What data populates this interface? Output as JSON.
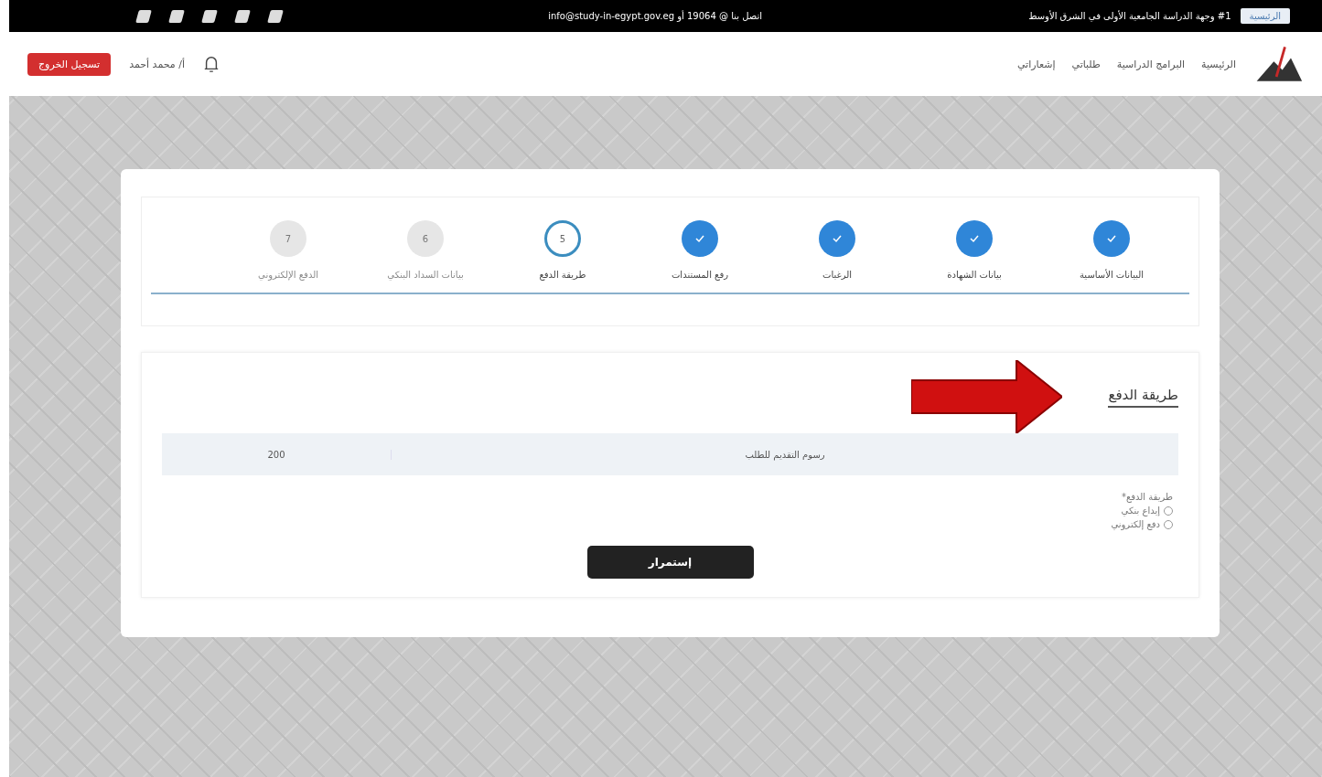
{
  "top_bar": {
    "badge": "الرئيسية",
    "tagline": "#1 وجهة الدراسة الجامعية الأولى في الشرق الأوسط",
    "contact": "اتصل بنا @ 19064 أو info@study-in-egypt.gov.eg"
  },
  "nav": {
    "items": [
      {
        "label": "الرئيسية"
      },
      {
        "label": "البرامج الدراسية"
      },
      {
        "label": "طلباتي"
      },
      {
        "label": "إشعاراتي"
      }
    ],
    "user": "أ/ محمد أحمد",
    "logout": "تسجيل الخروج"
  },
  "steps": [
    {
      "label": "البيانات الأساسية",
      "completed": true,
      "current": false
    },
    {
      "label": "بيانات الشهادة",
      "completed": true,
      "current": false
    },
    {
      "label": "الرغبات",
      "completed": true,
      "current": false
    },
    {
      "label": "رفع المستندات",
      "completed": true,
      "current": false
    },
    {
      "label": "طريقة الدفع",
      "completed": false,
      "current": true,
      "number": "5"
    },
    {
      "label": "بيانات السداد البنكي",
      "completed": false,
      "current": false,
      "number": "6"
    },
    {
      "label": "الدفع الإلكتروني",
      "completed": false,
      "current": false,
      "number": "7"
    }
  ],
  "payment": {
    "title": "طريقة الدفع",
    "fee_label": "رسوم التقديم للطلب",
    "fee_value": "200",
    "method_label": "طريقة الدفع*",
    "options": [
      {
        "label": "إيداع بنكي",
        "selected": false
      },
      {
        "label": "دفع إلكتروني",
        "selected": false
      }
    ],
    "submit": "إستمرار"
  }
}
